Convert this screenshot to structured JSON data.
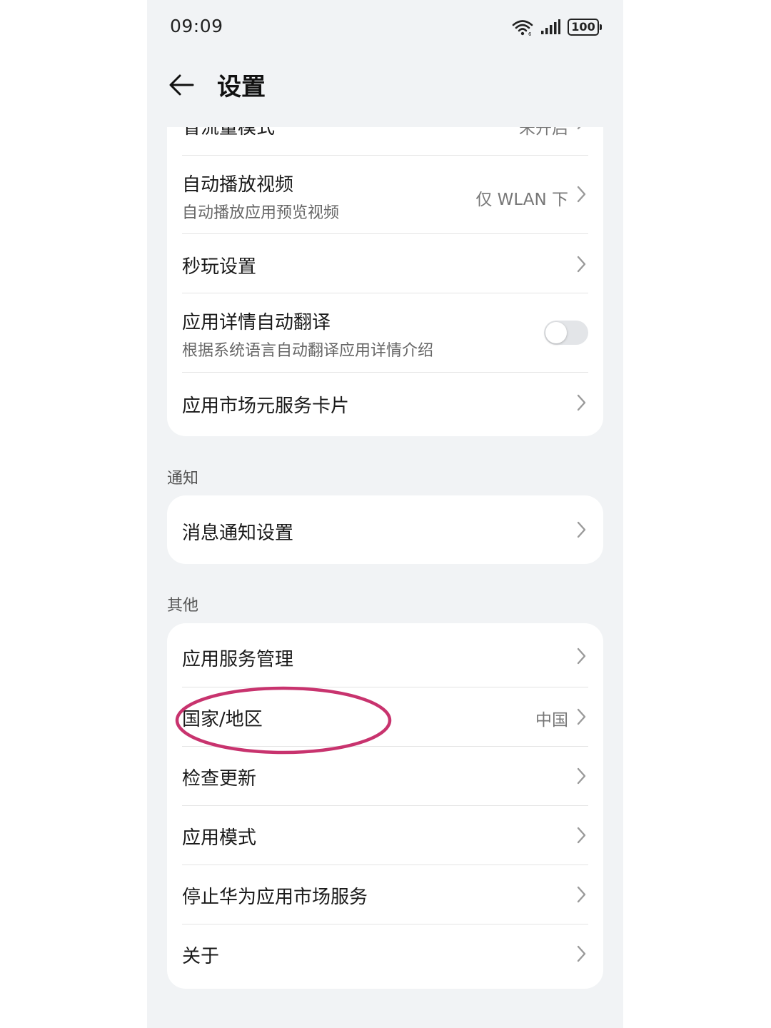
{
  "status_bar": {
    "time": "09:09",
    "battery": "100"
  },
  "header": {
    "title": "设置"
  },
  "cards": {
    "top": {
      "partial_row": {
        "title": "省流量模式",
        "value": "未开启"
      },
      "rows": [
        {
          "title": "自动播放视频",
          "subtitle": "自动播放应用预览视频",
          "value": "仅 WLAN 下"
        },
        {
          "title": "秒玩设置"
        },
        {
          "title": "应用详情自动翻译",
          "subtitle": "根据系统语言自动翻译应用详情介绍",
          "toggle_on": false
        },
        {
          "title": "应用市场元服务卡片"
        }
      ]
    },
    "notify": {
      "label": "通知",
      "rows": [
        {
          "title": "消息通知设置"
        }
      ]
    },
    "other": {
      "label": "其他",
      "rows": [
        {
          "title": "应用服务管理"
        },
        {
          "title": "国家/地区",
          "value": "中国"
        },
        {
          "title": "检查更新"
        },
        {
          "title": "应用模式"
        },
        {
          "title": "停止华为应用市场服务"
        },
        {
          "title": "关于"
        }
      ]
    }
  },
  "colors": {
    "background": "#f1f3f5",
    "card": "#ffffff",
    "annotation": "#c8336e",
    "toggle_off": "#e3e5e8"
  }
}
